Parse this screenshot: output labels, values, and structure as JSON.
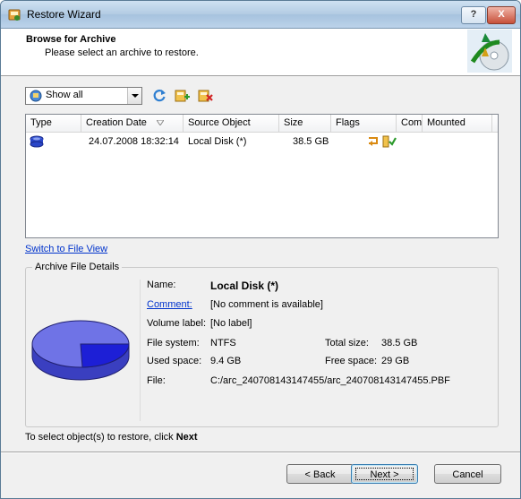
{
  "window": {
    "title": "Restore Wizard"
  },
  "title_buttons": {
    "help": "?",
    "close": "X"
  },
  "header": {
    "title": "Browse for Archive",
    "subtitle": "Please select an archive to restore."
  },
  "toolbar": {
    "filter_value": "Show all"
  },
  "list": {
    "columns": [
      "Type",
      "Creation Date",
      "Source Object",
      "Size",
      "Flags",
      "Comm",
      "Mounted"
    ],
    "rows": [
      {
        "type_icon": "disk-image-icon",
        "creation_date": "24.07.2008 18:32:14",
        "source_object": "Local Disk (*)",
        "size": "38.5 GB",
        "comment": "",
        "mounted": ""
      }
    ]
  },
  "switch_link": "Switch to File View",
  "details": {
    "legend": "Archive File Details",
    "name_label": "Name:",
    "name_value": "Local Disk (*)",
    "comment_label": "Comment:",
    "comment_value": "[No comment is available]",
    "volume_label": "Volume label:",
    "volume_value": "[No label]",
    "fs_label": "File system:",
    "fs_value": "NTFS",
    "total_label": "Total size:",
    "total_value": "38.5 GB",
    "used_label": "Used space:",
    "used_value": "9.4 GB",
    "free_label": "Free space:",
    "free_value": "29 GB",
    "file_label": "File:",
    "file_value": "C:/arc_240708143147455/arc_240708143147455.PBF",
    "used_fraction": 0.244,
    "pie_colors": {
      "free": "#6f73e6",
      "used": "#1d1fd6"
    }
  },
  "footer": {
    "hint_prefix": "To select object(s) to restore, click ",
    "hint_bold": "Next"
  },
  "buttons": {
    "back": "< Back",
    "next": "Next >",
    "cancel": "Cancel"
  }
}
